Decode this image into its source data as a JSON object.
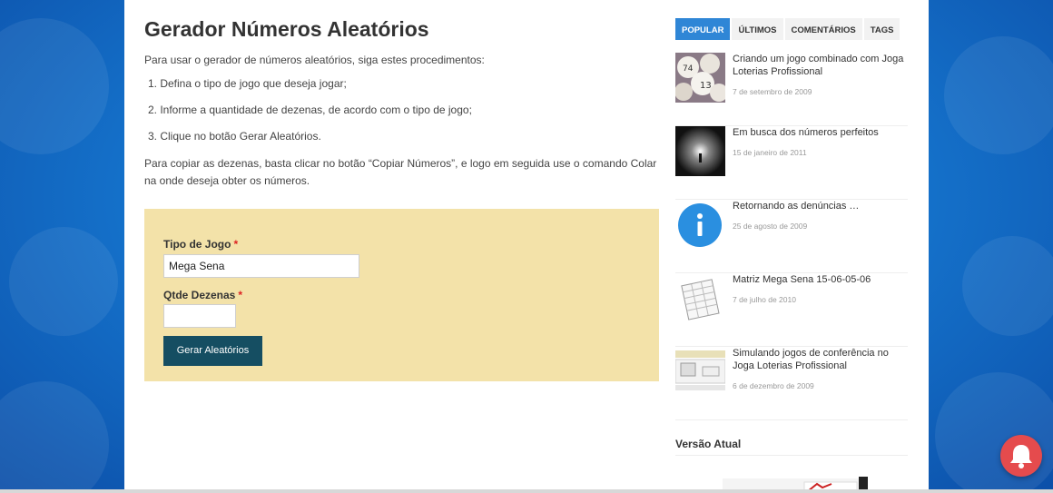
{
  "main": {
    "title": "Gerador Números Aleatórios",
    "intro": "Para usar o gerador de números aleatórios, siga estes procedimentos:",
    "steps": [
      "1. Defina o tipo de jogo que deseja jogar;",
      "2. Informe a quantidade de dezenas, de acordo com o tipo de jogo;",
      "3. Clique no botão Gerar Aleatórios."
    ],
    "copy_note": "Para copiar as dezenas, basta clicar no botão “Copiar Números”, e logo em seguida use o comando Colar na onde deseja obter os números."
  },
  "form": {
    "game_type_label": "Tipo de Jogo",
    "game_type_value": "Mega Sena",
    "count_label": "Qtde Dezenas",
    "count_value": "",
    "required_mark": "*",
    "generate_button": "Gerar Aleatórios",
    "background_color": "#f3e2a9",
    "button_color": "#154e62"
  },
  "sidebar": {
    "tabs": [
      "POPULAR",
      "ÚLTIMOS",
      "COMENTÁRIOS",
      "TAGS"
    ],
    "active_tab": "POPULAR",
    "accent_color": "#2f86d6",
    "posts": [
      {
        "title": "Criando um jogo combinado com Joga Loterias Profissional",
        "date": "7 de setembro de 2009",
        "thumb": "lottery-balls-image"
      },
      {
        "title": "Em busca dos números perfeitos",
        "date": "15 de janeiro de 2011",
        "thumb": "tunnel-light-image"
      },
      {
        "title": "Retornando as denúncias …",
        "date": "25 de agosto de 2009",
        "thumb": "info-icon"
      },
      {
        "title": "Matriz Mega Sena 15-06-05-06",
        "date": "7 de julho de 2010",
        "thumb": "spreadsheet-image"
      },
      {
        "title": "Simulando jogos de conferência no Joga Loterias Profissional",
        "date": "6 de dezembro de 2009",
        "thumb": "software-screenshot-image"
      }
    ],
    "current_version_title": "Versão Atual"
  }
}
